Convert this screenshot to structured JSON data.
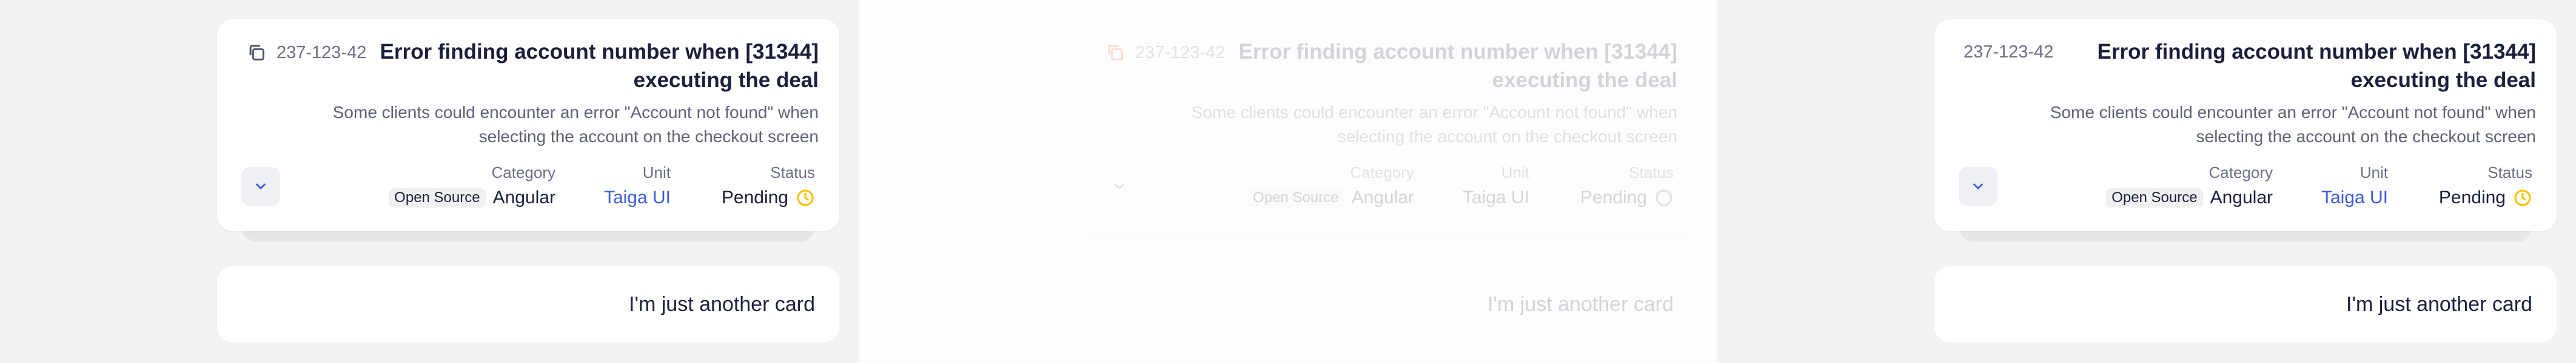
{
  "card": {
    "id": "237-123-42",
    "title": "Error finding account number when [31344] executing the deal",
    "description": "Some clients could encounter an error \"Account not found\" when selecting the account on the checkout screen",
    "category_label": "Category",
    "category_badge": "Open Source",
    "category_value": "Angular",
    "unit_label": "Unit",
    "unit_value": "Taiga UI",
    "status_label": "Status",
    "status_value": "Pending"
  },
  "second_card": {
    "text": "I'm just another card"
  },
  "colors": {
    "accent_orange": "#f05a22",
    "status_yellow": "#f5c518",
    "link_blue": "#3b5bdb",
    "text_dark": "#1b1f3b",
    "text_muted": "#6c6f86"
  },
  "icons": {
    "copy": "copy-icon",
    "expand": "chevron-down-icon",
    "status": "clock-icon"
  }
}
